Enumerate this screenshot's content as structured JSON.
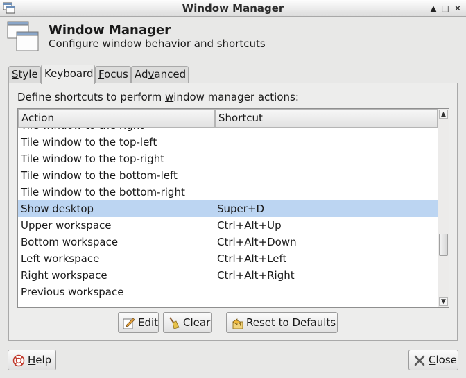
{
  "window": {
    "title": "Window Manager",
    "controls": [
      "▲",
      "□",
      "✕"
    ]
  },
  "header": {
    "title": "Window Manager",
    "subtitle": "Configure window behavior and shortcuts"
  },
  "tabs": [
    {
      "mn": "S",
      "rest": "tyle",
      "active": false
    },
    {
      "mn": "",
      "rest": "Keyboard",
      "active": true
    },
    {
      "mn": "F",
      "rest": "ocus",
      "active": false
    },
    {
      "mn": "",
      "pre": "Ad",
      "mid": "v",
      "rest": "anced",
      "active": false
    }
  ],
  "keyboard": {
    "desc_pre": "Define shortcuts to perform ",
    "desc_mn": "w",
    "desc_post": "indow manager actions:",
    "columns": {
      "action": "Action",
      "shortcut": "Shortcut"
    },
    "rows": [
      {
        "action": "Tile window to the right",
        "shortcut": ""
      },
      {
        "action": "Tile window to the top-left",
        "shortcut": ""
      },
      {
        "action": "Tile window to the top-right",
        "shortcut": ""
      },
      {
        "action": "Tile window to the bottom-left",
        "shortcut": ""
      },
      {
        "action": "Tile window to the bottom-right",
        "shortcut": ""
      },
      {
        "action": "Show desktop",
        "shortcut": "Super+D",
        "selected": true
      },
      {
        "action": "Upper workspace",
        "shortcut": "Ctrl+Alt+Up"
      },
      {
        "action": "Bottom workspace",
        "shortcut": "Ctrl+Alt+Down"
      },
      {
        "action": "Left workspace",
        "shortcut": "Ctrl+Alt+Left"
      },
      {
        "action": "Right workspace",
        "shortcut": "Ctrl+Alt+Right"
      },
      {
        "action": "Previous workspace",
        "shortcut": ""
      }
    ],
    "buttons": {
      "edit": {
        "mn": "E",
        "rest": "dit"
      },
      "clear": {
        "mn": "C",
        "rest": "lear"
      },
      "reset": {
        "mn": "R",
        "rest": "eset to Defaults"
      }
    }
  },
  "footer": {
    "help": {
      "mn": "H",
      "rest": "elp"
    },
    "close": {
      "mn": "C",
      "rest": "lose"
    }
  },
  "colors": {
    "selection": "#bcd5f2",
    "panel": "#ededec",
    "background": "#e8e8e7"
  }
}
